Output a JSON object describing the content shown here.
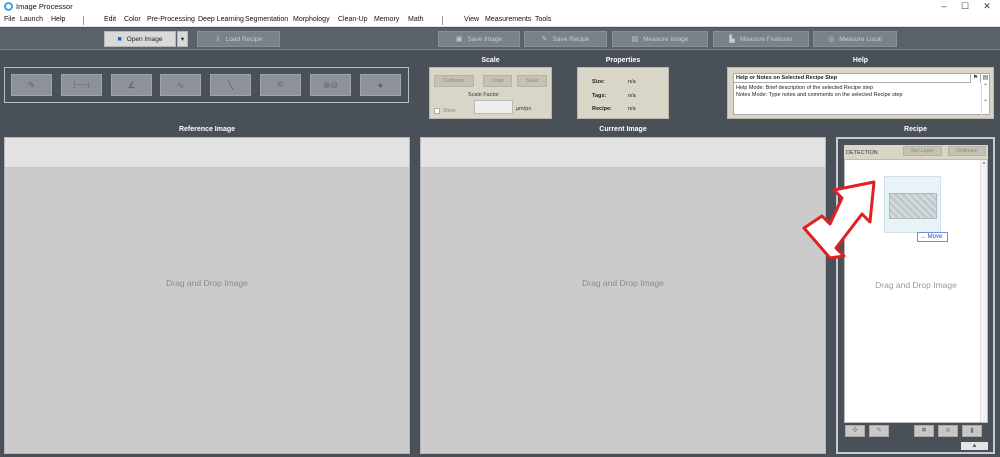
{
  "window": {
    "title": "Image Processor",
    "controls": [
      "–",
      "☐",
      "✕"
    ]
  },
  "menubar": {
    "items": [
      "File",
      "Launch",
      "Help",
      "Edit",
      "Color",
      "Pre-Processing",
      "Deep Learning",
      "Segmentation",
      "Morphology",
      "Clean-Up",
      "Memory",
      "Math",
      "View",
      "Measurements",
      "Tools"
    ]
  },
  "toolbar": {
    "open_image": "Open Image",
    "load_recipe": "Load Recipe",
    "save_image": "Save Image",
    "save_recipe": "Save Recipe",
    "measure_image": "Measure Image",
    "measure_features": "Measure Features",
    "measure_local": "Measure Local"
  },
  "headers": {
    "scale": "Scale",
    "properties": "Properties",
    "help": "Help",
    "reference_image": "Reference Image",
    "current_image": "Current Image",
    "recipe": "Recipe"
  },
  "tools": [
    {
      "icon": "pencil-icon",
      "glyph": "✎"
    },
    {
      "icon": "width-measure-icon",
      "glyph": "⊢⊣"
    },
    {
      "icon": "angle-icon",
      "glyph": "∡"
    },
    {
      "icon": "profile-line-icon",
      "glyph": "∿"
    },
    {
      "icon": "ruler-icon",
      "glyph": "╲"
    },
    {
      "icon": "id-icon",
      "glyph": "ID"
    },
    {
      "icon": "zoom-icon",
      "glyph": "⊕⊖"
    },
    {
      "icon": "circle-icon",
      "glyph": "●"
    }
  ],
  "scale": {
    "calibrate": "Calibrate",
    "load": "Load",
    "save": "Save",
    "factor_label": "Scale Factor",
    "unit": "µm/px",
    "show": "Show"
  },
  "properties": {
    "size_label": "Size:",
    "size_value": "n/a",
    "tags_label": "Tags:",
    "tags_value": "n/a",
    "recipe_label": "Recipe:",
    "recipe_value": "n/a"
  },
  "help": {
    "heading": "Help or Notes on Selected Recipe Step",
    "line1": "Help Mode:   Brief description of the selected Recipe step",
    "line2": "Notes Mode:  Type notes and comments on the selected Recipe step"
  },
  "reference": {
    "drag": "Drag and Drop Image"
  },
  "current": {
    "drag": "Drag and Drop Image"
  },
  "recipe": {
    "detection": "DETECTION",
    "set_layer": "Set Layer",
    "optimize": "Optimize",
    "drag": "Drag and Drop Image",
    "move": "→ Move"
  },
  "colors": {
    "background": "#4a5058",
    "panel_beige": "#d9d6c8",
    "image_gray": "#cbcbcb",
    "annotation_red": "#e02020",
    "app_icon": "#3aa6d8"
  }
}
